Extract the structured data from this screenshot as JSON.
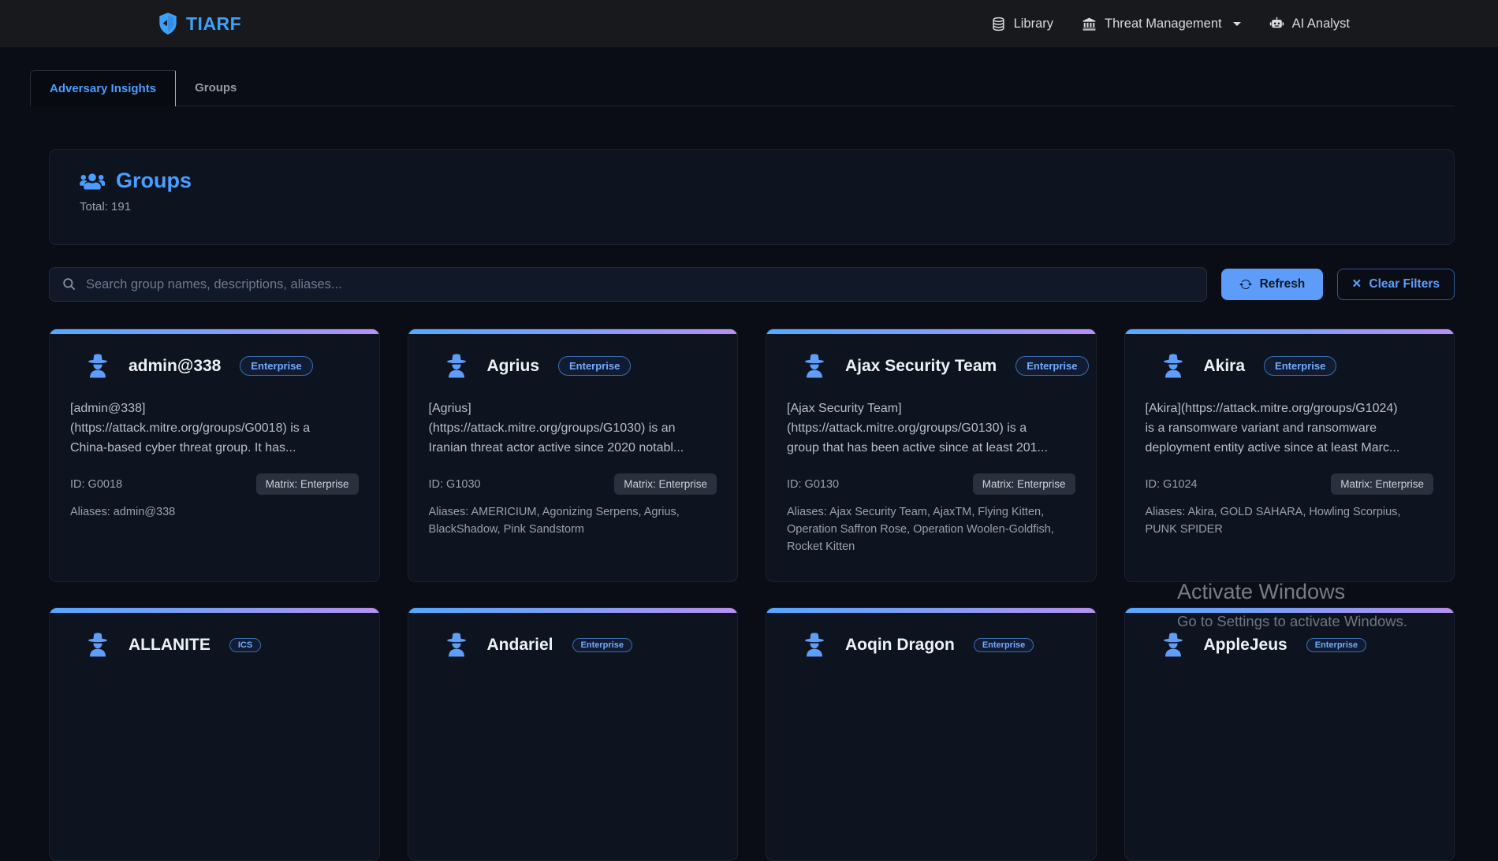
{
  "brand": {
    "name": "TIARF"
  },
  "nav": {
    "library_label": "Library",
    "threat_management_label": "Threat Management",
    "ai_analyst_label": "AI Analyst"
  },
  "tabs": {
    "adversary_insights": "Adversary Insights",
    "groups": "Groups"
  },
  "section": {
    "title": "Groups",
    "total_label": "Total: 191"
  },
  "search": {
    "placeholder": "Search group names, descriptions, aliases..."
  },
  "toolbar": {
    "refresh_label": "Refresh",
    "clear_filters_label": "Clear Filters"
  },
  "colors": {
    "accent_blue": "#4a9eff",
    "button_blue": "#5d9cf8",
    "card_gradient_left": "#54a9ff",
    "card_gradient_right": "#b890f2",
    "navbar_bg": "#17191d",
    "page_bg": "#0a0d16",
    "card_bg": "#0d1420"
  },
  "groups": [
    {
      "name": "admin@338",
      "badge": "Enterprise",
      "description": "[admin@338]\n(https://attack.mitre.org/groups/G0018) is a\nChina-based cyber threat group. It has...",
      "id": "ID: G0018",
      "matrix": "Matrix: Enterprise",
      "aliases": "Aliases: admin@338"
    },
    {
      "name": "Agrius",
      "badge": "Enterprise",
      "description": "[Agrius]\n(https://attack.mitre.org/groups/G1030) is an\nIranian threat actor active since 2020 notabl...",
      "id": "ID: G1030",
      "matrix": "Matrix: Enterprise",
      "aliases": "Aliases: AMERICIUM, Agonizing Serpens, Agrius, BlackShadow, Pink Sandstorm"
    },
    {
      "name": "Ajax Security Team",
      "badge": "Enterprise",
      "description": "[Ajax Security Team]\n(https://attack.mitre.org/groups/G0130) is a\ngroup that has been active since at least 201...",
      "id": "ID: G0130",
      "matrix": "Matrix: Enterprise",
      "aliases": "Aliases: Ajax Security Team, AjaxTM, Flying Kitten, Operation Saffron Rose, Operation Woolen-Goldfish, Rocket Kitten"
    },
    {
      "name": "Akira",
      "badge": "Enterprise",
      "description": "[Akira](https://attack.mitre.org/groups/G1024)\nis a ransomware variant and ransomware\ndeployment entity active since at least Marc...",
      "id": "ID: G1024",
      "matrix": "Matrix: Enterprise",
      "aliases": "Aliases: Akira, GOLD SAHARA, Howling Scorpius, PUNK SPIDER"
    }
  ],
  "groups_row2": [
    {
      "name": "ALLANITE",
      "badge": "ICS"
    },
    {
      "name": "Andariel",
      "badge": "Enterprise"
    },
    {
      "name": "Aoqin Dragon",
      "badge": "Enterprise"
    },
    {
      "name": "AppleJeus",
      "badge": "Enterprise"
    }
  ],
  "watermark": {
    "line1": "Activate Windows",
    "line2": "Go to Settings to activate Windows."
  }
}
